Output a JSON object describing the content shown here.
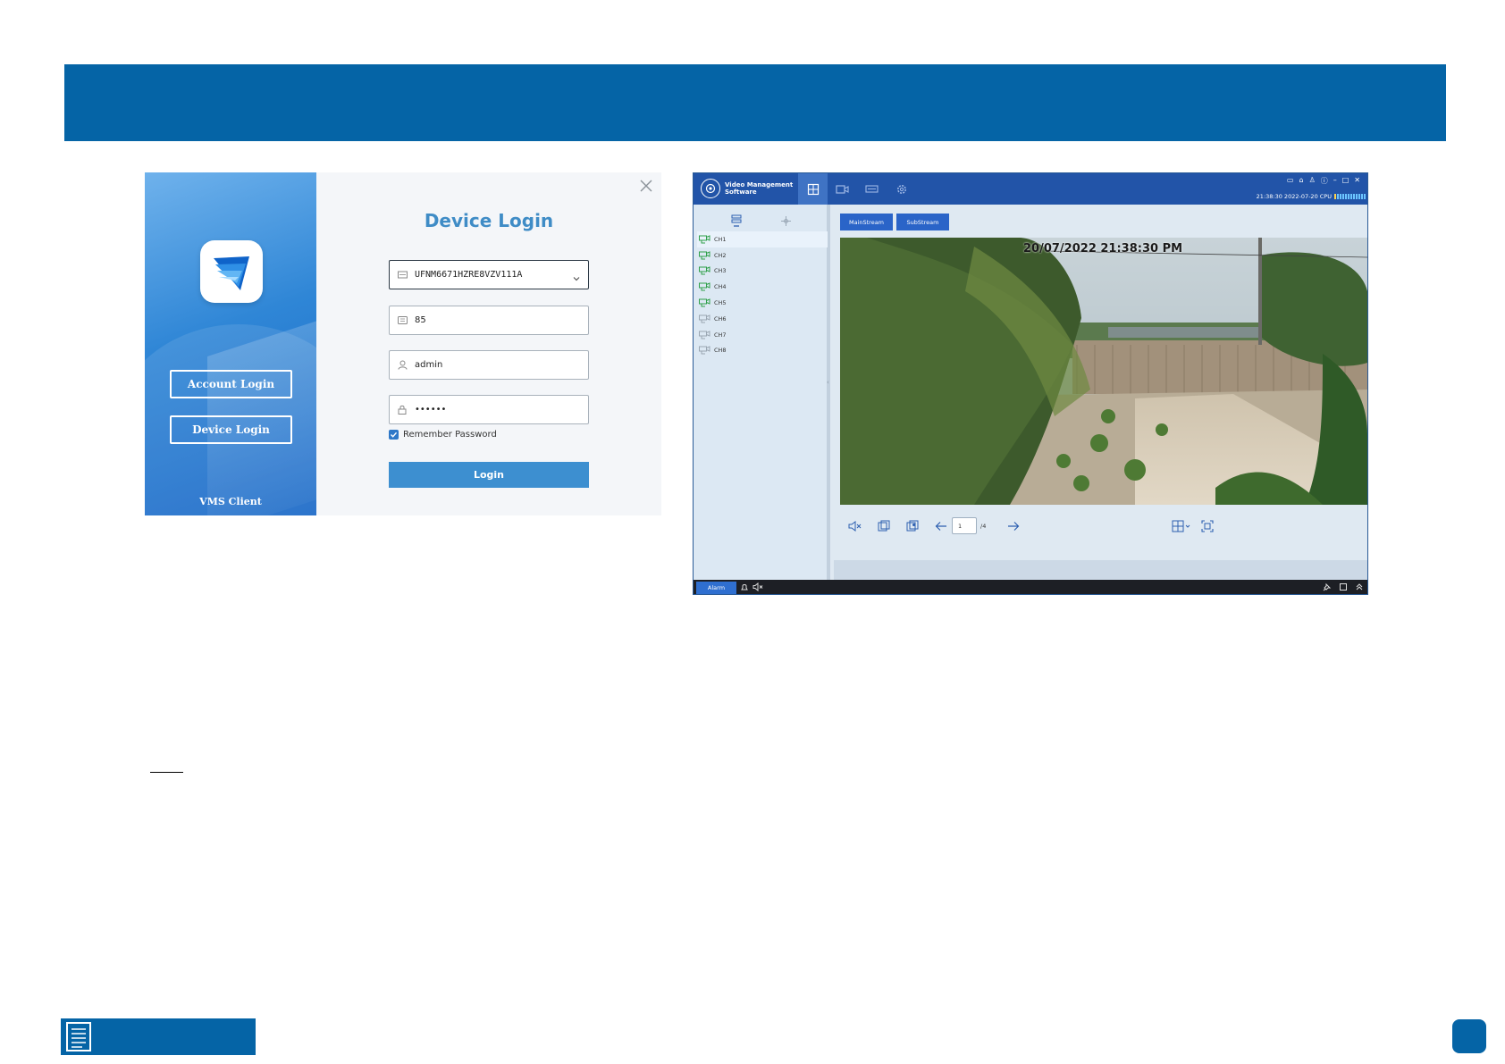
{
  "login": {
    "title": "Device Login",
    "side_account_label": "Account Login",
    "side_device_label": "Device Login",
    "client_label": "VMS Client",
    "device_id_value": "UFNM6671HZRE8VZV111A",
    "port_value": "85",
    "username_value": "admin",
    "password_value": "••••••",
    "remember_label": "Remember Password",
    "remember_checked": true,
    "login_button_label": "Login",
    "accent_color": "#3d8fd0"
  },
  "vms": {
    "app_name_line1": "Video Management",
    "app_name_line2": "Software",
    "time_text": "21:38:30 2022-07-20 CPU",
    "mainstream_label": "MainStream",
    "substream_label": "SubStream",
    "channels": [
      {
        "label": "CH1",
        "online": true
      },
      {
        "label": "CH2",
        "online": true
      },
      {
        "label": "CH3",
        "online": true
      },
      {
        "label": "CH4",
        "online": true
      },
      {
        "label": "CH5",
        "online": true
      },
      {
        "label": "CH6",
        "online": false
      },
      {
        "label": "CH7",
        "online": false
      },
      {
        "label": "CH8",
        "online": false
      }
    ],
    "video_timestamp": "20/07/2022 21:38:30 PM",
    "page_current": "1",
    "page_total": "/4",
    "alarm_label": "Alarm",
    "header_color": "#2254a8"
  },
  "colors": {
    "banner": "#0564a6"
  }
}
